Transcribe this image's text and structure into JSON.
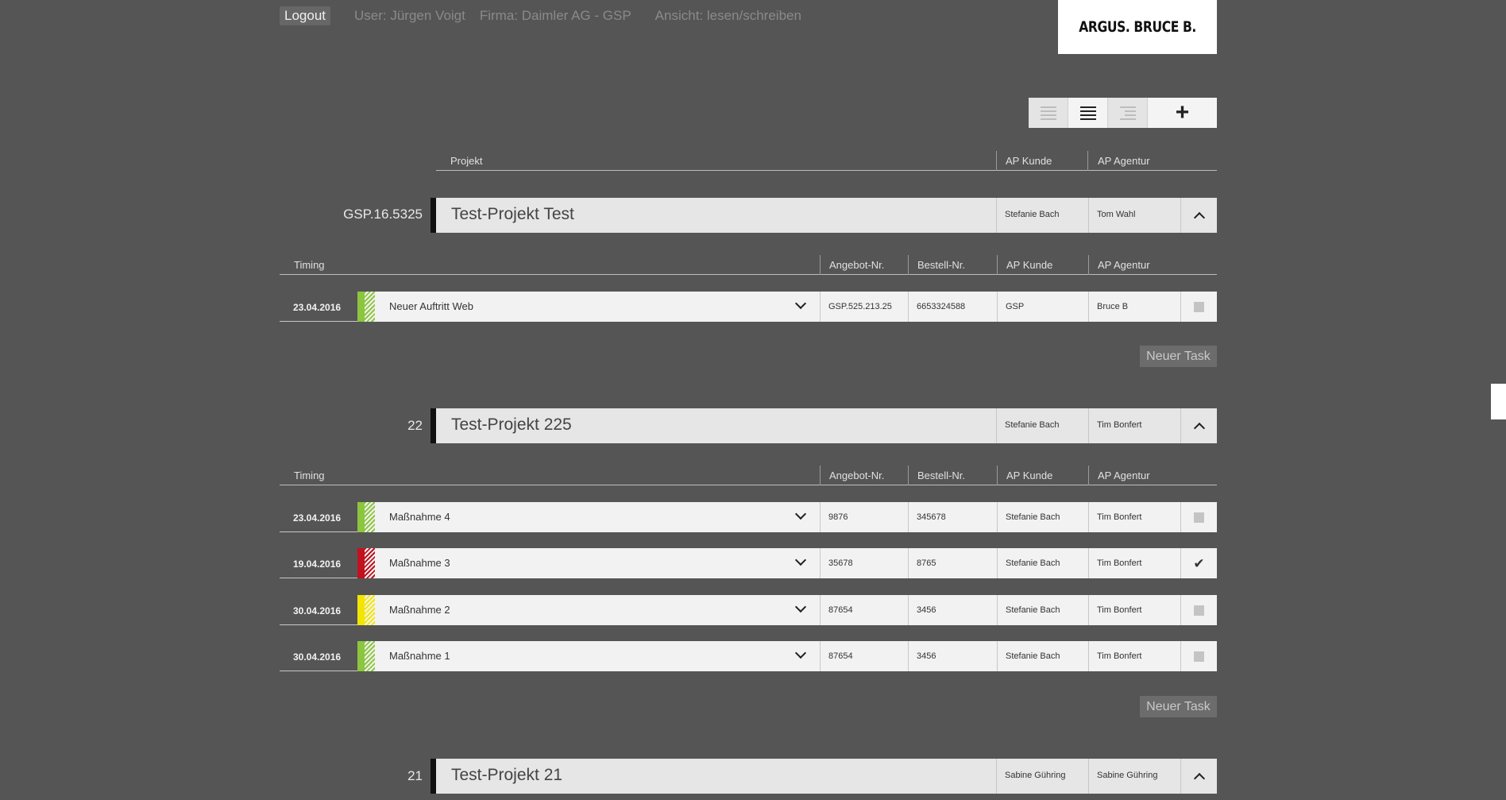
{
  "topbar": {
    "logout": "Logout",
    "user": "User: Jürgen Voigt",
    "firma": "Firma: Daimler AG - GSP",
    "ansicht": "Ansicht: lesen/schreiben"
  },
  "logo": "ARGUS. BRUCE B.",
  "viewbar": {
    "plus": "+"
  },
  "project_header": {
    "projekt": "Projekt",
    "ap_kunde": "AP Kunde",
    "ap_agentur": "AP Agentur"
  },
  "task_header": {
    "timing": "Timing",
    "angebot": "Angebot-Nr.",
    "bestell": "Bestell-Nr.",
    "ap_kunde": "AP Kunde",
    "ap_agentur": "AP Agentur"
  },
  "colors": {
    "green": "#8cc63f",
    "red": "#c1121f",
    "yellow": "#f2e600"
  },
  "projects": [
    {
      "number": "GSP.16.5325",
      "name": "Test-Projekt Test",
      "ap_kunde": "Stefanie Bach",
      "ap_agentur": "Tom Wahl",
      "new_task": "Neuer Task",
      "tasks": [
        {
          "date": "23.04.2016",
          "status": "green",
          "name": "Neuer Auftritt Web",
          "angebot": "GSP.525.213.25",
          "bestell": "6653324588",
          "ap_kunde": "GSP",
          "ap_agentur": "Bruce B",
          "checked": false
        }
      ]
    },
    {
      "number": "22",
      "name": "Test-Projekt 225",
      "ap_kunde": "Stefanie Bach",
      "ap_agentur": "Tim Bonfert",
      "new_task": "Neuer Task",
      "tasks": [
        {
          "date": "23.04.2016",
          "status": "green",
          "name": "Maßnahme 4",
          "angebot": "9876",
          "bestell": "345678",
          "ap_kunde": "Stefanie Bach",
          "ap_agentur": "Tim Bonfert",
          "checked": false
        },
        {
          "date": "19.04.2016",
          "status": "red",
          "name": "Maßnahme 3",
          "angebot": "35678",
          "bestell": "8765",
          "ap_kunde": "Stefanie Bach",
          "ap_agentur": "Tim Bonfert",
          "checked": true,
          "check_mark": "✔"
        },
        {
          "date": "30.04.2016",
          "status": "yellow",
          "name": "Maßnahme 2",
          "angebot": "87654",
          "bestell": "3456",
          "ap_kunde": "Stefanie Bach",
          "ap_agentur": "Tim Bonfert",
          "checked": false
        },
        {
          "date": "30.04.2016",
          "status": "green",
          "name": "Maßnahme 1",
          "angebot": "87654",
          "bestell": "3456",
          "ap_kunde": "Stefanie Bach",
          "ap_agentur": "Tim Bonfert",
          "checked": false
        }
      ]
    },
    {
      "number": "21",
      "name": "Test-Projekt 21",
      "ap_kunde": "Sabine Gühring",
      "ap_agentur": "Sabine Gühring",
      "tasks": []
    }
  ]
}
